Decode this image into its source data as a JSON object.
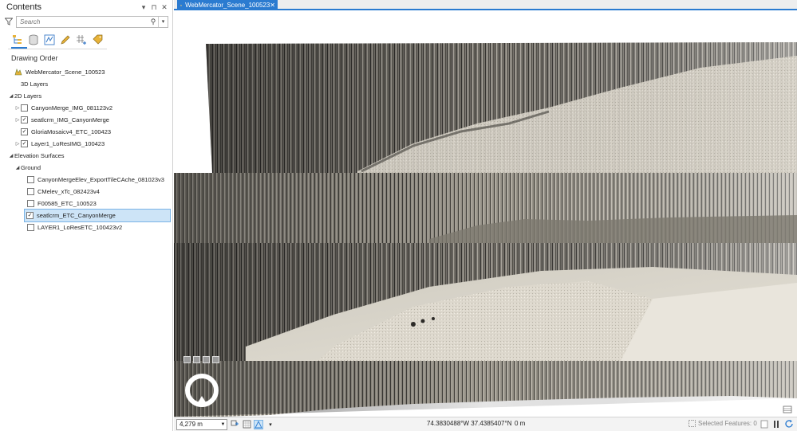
{
  "contents": {
    "title": "Contents",
    "controls": {
      "dropdown": "▾",
      "pin": "⊓",
      "close": "✕"
    },
    "search": {
      "placeholder": "Search"
    },
    "drawing_order_label": "Drawing Order",
    "tree": [
      {
        "label": "WebMercator_Scene_100523",
        "indent": 0,
        "type": "map",
        "expander": ""
      },
      {
        "label": "3D Layers",
        "indent": 1,
        "type": "group",
        "expander": ""
      },
      {
        "label": "2D Layers",
        "indent": 0,
        "type": "group",
        "expander": "◢"
      },
      {
        "label": "CanyonMerge_IMG_081123v2",
        "indent": 1,
        "type": "layer",
        "expander": "▷",
        "checked": false
      },
      {
        "label": "seatlcrm_IMG_CanyonMerge",
        "indent": 1,
        "type": "layer",
        "expander": "▷",
        "checked": true
      },
      {
        "label": "GloriaMosaicv4_ETC_100423",
        "indent": 1,
        "type": "layer",
        "expander": "",
        "checked": true
      },
      {
        "label": "Layer1_LoResIMG_100423",
        "indent": 1,
        "type": "layer",
        "expander": "▷",
        "checked": true
      },
      {
        "label": "Elevation Surfaces",
        "indent": 0,
        "type": "group",
        "expander": "◢"
      },
      {
        "label": "Ground",
        "indent": 1,
        "type": "group",
        "expander": "◢"
      },
      {
        "label": "CanyonMergeElev_ExportTileCAche_081023v3",
        "indent": 2,
        "type": "layer",
        "expander": "",
        "checked": false
      },
      {
        "label": "CMelev_xTc_082423v4",
        "indent": 2,
        "type": "layer",
        "expander": "",
        "checked": false
      },
      {
        "label": "F00585_ETC_100523",
        "indent": 2,
        "type": "layer",
        "expander": "",
        "checked": false
      },
      {
        "label": "seatlcrm_ETC_CanyonMerge",
        "indent": 2,
        "type": "layer",
        "expander": "",
        "checked": true,
        "selected": true
      },
      {
        "label": "LAYER1_LoResETC_100423v2",
        "indent": 2,
        "type": "layer",
        "expander": "",
        "checked": false
      }
    ]
  },
  "tab": {
    "label": "WebMercator_Scene_100523",
    "close": "✕"
  },
  "status": {
    "scale": "4,279 m",
    "coordinates": "74.3830488°W 37.4385407°N",
    "elevation": "0 m",
    "selected_features": "Selected Features: 0"
  },
  "colors": {
    "accent": "#2b7bd0",
    "selection": "#cde4f7"
  }
}
